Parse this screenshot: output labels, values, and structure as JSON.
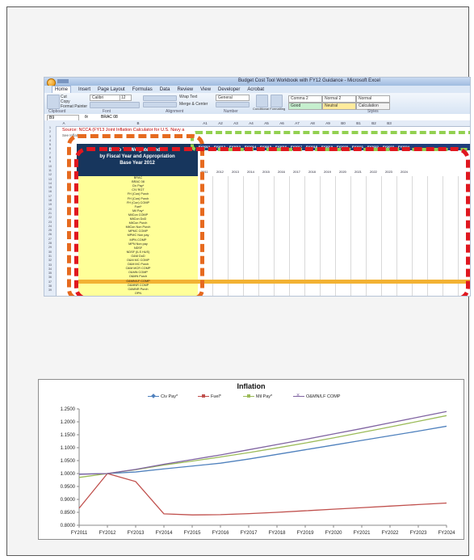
{
  "excel": {
    "title_bar": "Budget Cost Tool Workbook with FY12 Guidance - Microsoft Excel",
    "menu": [
      "Home",
      "Insert",
      "Page Layout",
      "Formulas",
      "Data",
      "Review",
      "View",
      "Developer",
      "Acrobat"
    ],
    "active_menu": "Home",
    "clipboard": {
      "cut": "Cut",
      "copy": "Copy",
      "paste": "Paste",
      "format_painter": "Format Painter",
      "group": "Clipboard"
    },
    "font": {
      "name": "Calibri",
      "size": "12",
      "group": "Font"
    },
    "alignment_group": "Alignment",
    "wrap_text": "Wrap Text",
    "merge_center": "Merge & Center",
    "number_format": "General",
    "number_group": "Number",
    "styles_group": "Styles",
    "conditional_formatting": "Conditional Formatting",
    "format_as_table": "Format as Table",
    "styles": [
      {
        "label": "Comma 2",
        "bg": "#ffffff"
      },
      {
        "label": "Normal 2",
        "bg": "#ffffff"
      },
      {
        "label": "Normal",
        "bg": "#ffffff"
      },
      {
        "label": "Good",
        "bg": "#c6efce"
      },
      {
        "label": "Neutral",
        "bg": "#ffeb9c"
      },
      {
        "label": "Calculation",
        "bg": "#f2f2f2"
      }
    ],
    "name_box": "B9",
    "formula_fx": "fx",
    "formula_value": "BRAC 08",
    "columns": [
      "A",
      "B",
      "A1",
      "A2",
      "A3",
      "A4",
      "A5",
      "A6",
      "A7",
      "A8",
      "A9",
      "B0",
      "B1",
      "B2",
      "B3"
    ],
    "source_text": "Source: NCCA (FY13 Joint Inflation Calculator for U.S. Navy a",
    "source_text2": "See Inflation",
    "table_header": [
      "BY to TY Weighted Index",
      "by Fiscal Year and Appropriation",
      "Base Year 2012"
    ],
    "year_headers": [
      "FY2010",
      "FY2012",
      "FY2013",
      "FY2014",
      "FY2015",
      "FY2016",
      "FY2017",
      "FY2018",
      "FY2019",
      "FY2020",
      "FY2021",
      "FY2022",
      "FY2023",
      "FY2024"
    ],
    "year_subheaders": [
      "2011",
      "2012",
      "2013",
      "2014",
      "2015",
      "2016",
      "2017",
      "2018",
      "2019",
      "2020",
      "2021",
      "2022",
      "2023",
      "2024"
    ],
    "row_labels": [
      "BRAC",
      "BRAC 08",
      "Civ Pay*",
      "CIV RGT",
      "FH (Con) Purch",
      "FH (Con) Purch",
      "FH (Con) COMP",
      "Fuel*",
      "Mil Pay*",
      "MilCon COMP",
      "MilCon DoD",
      "MilCon Purch",
      "MilCon Non Purch",
      "MPMC COMP",
      "MPMC Non pay",
      "MPN COMP",
      "MPN Non pay",
      "NDSF",
      "NDSF (ILS HUS)",
      "O&M DoD",
      "O&M MC COMP",
      "O&M MC Purch",
      "O&M MCR COMP",
      "O&MN COMP",
      "O&MN Purch",
      "O&MN/LF COMP",
      "O&MNR COMP",
      "O&MNR Purch",
      "OPN"
    ],
    "highlighted_row": "O&MN/LF COMP"
  },
  "chart_data": {
    "type": "line",
    "title": "Inflation",
    "xlabel": "",
    "ylabel": "",
    "x": [
      "FY2011",
      "FY2012",
      "FY2013",
      "FY2014",
      "FY2015",
      "FY2016",
      "FY2017",
      "FY2018",
      "FY2019",
      "FY2020",
      "FY2021",
      "FY2022",
      "FY2023",
      "FY2024"
    ],
    "ylim": [
      0.8,
      1.25
    ],
    "yticks": [
      "0.8000",
      "0.8500",
      "0.9000",
      "0.9500",
      "1.0000",
      "1.0500",
      "1.1000",
      "1.1500",
      "1.2000",
      "1.2500"
    ],
    "legend_position": "top",
    "grid": false,
    "series": [
      {
        "name": "Civ Pay*",
        "color": "#4f81bd",
        "marker": "diamond",
        "values": [
          0.998,
          1.0,
          1.006,
          1.018,
          1.029,
          1.04,
          1.056,
          1.074,
          1.092,
          1.11,
          1.128,
          1.146,
          1.164,
          1.183
        ]
      },
      {
        "name": "Fuel*",
        "color": "#c0504d",
        "marker": "square",
        "values": [
          0.866,
          1.0,
          0.969,
          0.844,
          0.84,
          0.841,
          0.845,
          0.85,
          0.856,
          0.862,
          0.868,
          0.874,
          0.88,
          0.886
        ]
      },
      {
        "name": "Mil Pay*",
        "color": "#9bbb59",
        "marker": "triangle",
        "values": [
          0.985,
          1.0,
          1.015,
          1.033,
          1.048,
          1.064,
          1.081,
          1.099,
          1.118,
          1.138,
          1.159,
          1.18,
          1.202,
          1.224
        ]
      },
      {
        "name": "O&MN/LF COMP",
        "color": "#8064a2",
        "marker": "x",
        "values": [
          0.997,
          1.0,
          1.016,
          1.036,
          1.054,
          1.072,
          1.092,
          1.112,
          1.132,
          1.153,
          1.174,
          1.196,
          1.218,
          1.24
        ]
      }
    ]
  }
}
